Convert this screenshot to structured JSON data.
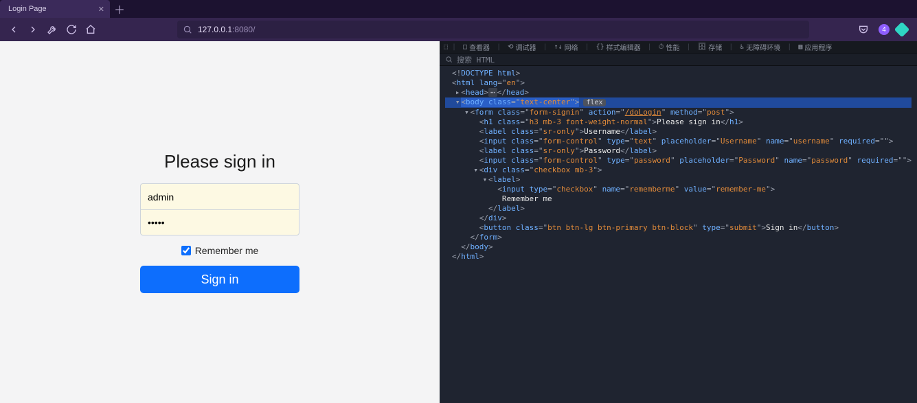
{
  "browser": {
    "tab_title": "Login Page",
    "address_host": "127.0.0.1",
    "address_rest": ":8080/",
    "badge_count": "4"
  },
  "login": {
    "heading": "Please sign in",
    "username_value": "admin",
    "username_placeholder": "Username",
    "password_value": "•••••",
    "password_placeholder": "Password",
    "remember_label": "Remember me",
    "submit_label": "Sign in"
  },
  "devtools": {
    "top_tabs": [
      "查看器",
      "调试器",
      "网络",
      "样式编辑器",
      "性能",
      "存储",
      "无障碍环境",
      "应用程序"
    ],
    "search_placeholder": "搜索 HTML",
    "flex_badge": "flex",
    "lines": [
      {
        "indent": 0,
        "tw": "",
        "html": "<span class='c-punct'>&lt;!</span><span class='c-tag'>DOCTYPE</span> <span class='c-attr'>html</span><span class='c-punct'>&gt;</span>"
      },
      {
        "indent": 0,
        "tw": "",
        "html": "<span class='c-punct'>&lt;</span><span class='c-tag'>html</span> <span class='c-attr'>lang</span><span class='c-punct'>=&quot;</span><span class='c-val'>en</span><span class='c-punct'>&quot;&gt;</span>"
      },
      {
        "indent": 1,
        "tw": "▸",
        "html": "<span class='c-punct'>&lt;</span><span class='c-tag'>head</span><span class='c-punct'>&gt;</span><span class='c-dots'>⋯</span><span class='c-punct'>&lt;/</span><span class='c-tag'>head</span><span class='c-punct'>&gt;</span>"
      },
      {
        "indent": 1,
        "tw": "▾",
        "selected": true,
        "html": "<span class='c-punct'>&lt;</span><span class='c-tag'>body</span> <span class='c-attr'>class</span><span class='c-punct'>=&quot;</span><span class='c-val'>text-center</span><span class='c-punct'>&quot;&gt;</span>"
      },
      {
        "indent": 2,
        "tw": "▾",
        "html": "<span class='c-punct'>&lt;</span><span class='c-tag'>form</span> <span class='c-attr'>class</span><span class='c-punct'>=&quot;</span><span class='c-val'>form-signin</span><span class='c-punct'>&quot;</span> <span class='c-attr'>action</span><span class='c-punct'>=&quot;</span><span class='c-link'>/doLogin</span><span class='c-punct'>&quot;</span> <span class='c-attr'>method</span><span class='c-punct'>=&quot;</span><span class='c-val'>post</span><span class='c-punct'>&quot;&gt;</span>"
      },
      {
        "indent": 3,
        "tw": "",
        "html": "<span class='c-punct'>&lt;</span><span class='c-tag'>h1</span> <span class='c-attr'>class</span><span class='c-punct'>=&quot;</span><span class='c-val'>h3 mb-3 font-weight-normal</span><span class='c-punct'>&quot;&gt;</span><span class='c-text'>Please sign in</span><span class='c-punct'>&lt;/</span><span class='c-tag'>h1</span><span class='c-punct'>&gt;</span>"
      },
      {
        "indent": 3,
        "tw": "",
        "html": "<span class='c-punct'>&lt;</span><span class='c-tag'>label</span> <span class='c-attr'>class</span><span class='c-punct'>=&quot;</span><span class='c-val'>sr-only</span><span class='c-punct'>&quot;&gt;</span><span class='c-text'>Username</span><span class='c-punct'>&lt;/</span><span class='c-tag'>label</span><span class='c-punct'>&gt;</span>"
      },
      {
        "indent": 3,
        "tw": "",
        "html": "<span class='c-punct'>&lt;</span><span class='c-tag'>input</span> <span class='c-attr'>class</span><span class='c-punct'>=&quot;</span><span class='c-val'>form-control</span><span class='c-punct'>&quot;</span> <span class='c-attr'>type</span><span class='c-punct'>=&quot;</span><span class='c-val'>text</span><span class='c-punct'>&quot;</span> <span class='c-attr'>placeholder</span><span class='c-punct'>=&quot;</span><span class='c-val'>Username</span><span class='c-punct'>&quot;</span> <span class='c-attr'>name</span><span class='c-punct'>=&quot;</span><span class='c-val'>username</span><span class='c-punct'>&quot;</span> <span class='c-attr'>required</span><span class='c-punct'>=&quot;&quot;&gt;</span>"
      },
      {
        "indent": 3,
        "tw": "",
        "html": "<span class='c-punct'>&lt;</span><span class='c-tag'>label</span> <span class='c-attr'>class</span><span class='c-punct'>=&quot;</span><span class='c-val'>sr-only</span><span class='c-punct'>&quot;&gt;</span><span class='c-text'>Password</span><span class='c-punct'>&lt;/</span><span class='c-tag'>label</span><span class='c-punct'>&gt;</span>"
      },
      {
        "indent": 3,
        "tw": "",
        "html": "<span class='c-punct'>&lt;</span><span class='c-tag'>input</span> <span class='c-attr'>class</span><span class='c-punct'>=&quot;</span><span class='c-val'>form-control</span><span class='c-punct'>&quot;</span> <span class='c-attr'>type</span><span class='c-punct'>=&quot;</span><span class='c-val'>password</span><span class='c-punct'>&quot;</span> <span class='c-attr'>placeholder</span><span class='c-punct'>=&quot;</span><span class='c-val'>Password</span><span class='c-punct'>&quot;</span> <span class='c-attr'>name</span><span class='c-punct'>=&quot;</span><span class='c-val'>password</span><span class='c-punct'>&quot;</span> <span class='c-attr'>required</span><span class='c-punct'>=&quot;&quot;&gt;</span>"
      },
      {
        "indent": 3,
        "tw": "▾",
        "html": "<span class='c-punct'>&lt;</span><span class='c-tag'>div</span> <span class='c-attr'>class</span><span class='c-punct'>=&quot;</span><span class='c-val'>checkbox mb-3</span><span class='c-punct'>&quot;&gt;</span>"
      },
      {
        "indent": 4,
        "tw": "▾",
        "html": "<span class='c-punct'>&lt;</span><span class='c-tag'>label</span><span class='c-punct'>&gt;</span>"
      },
      {
        "indent": 5,
        "tw": "",
        "html": "<span class='c-punct'>&lt;</span><span class='c-tag'>input</span> <span class='c-attr'>type</span><span class='c-punct'>=&quot;</span><span class='c-val'>checkbox</span><span class='c-punct'>&quot;</span> <span class='c-attr'>name</span><span class='c-punct'>=&quot;</span><span class='c-val'>rememberme</span><span class='c-punct'>&quot;</span> <span class='c-attr'>value</span><span class='c-punct'>=&quot;</span><span class='c-val'>remember-me</span><span class='c-punct'>&quot;&gt;</span>"
      },
      {
        "indent": 5,
        "tw": "",
        "html": "<span class='c-text'> Remember me </span>"
      },
      {
        "indent": 4,
        "tw": "",
        "html": "<span class='c-punct'>&lt;/</span><span class='c-tag'>label</span><span class='c-punct'>&gt;</span>"
      },
      {
        "indent": 3,
        "tw": "",
        "html": "<span class='c-punct'>&lt;/</span><span class='c-tag'>div</span><span class='c-punct'>&gt;</span>"
      },
      {
        "indent": 3,
        "tw": "",
        "html": "<span class='c-punct'>&lt;</span><span class='c-tag'>button</span> <span class='c-attr'>class</span><span class='c-punct'>=&quot;</span><span class='c-val'>btn btn-lg btn-primary btn-block</span><span class='c-punct'>&quot;</span> <span class='c-attr'>type</span><span class='c-punct'>=&quot;</span><span class='c-val'>submit</span><span class='c-punct'>&quot;&gt;</span><span class='c-text'>Sign in</span><span class='c-punct'>&lt;/</span><span class='c-tag'>button</span><span class='c-punct'>&gt;</span>"
      },
      {
        "indent": 2,
        "tw": "",
        "html": "<span class='c-punct'>&lt;/</span><span class='c-tag'>form</span><span class='c-punct'>&gt;</span>"
      },
      {
        "indent": 1,
        "tw": "",
        "html": "<span class='c-punct'>&lt;/</span><span class='c-tag'>body</span><span class='c-punct'>&gt;</span>"
      },
      {
        "indent": 0,
        "tw": "",
        "html": "<span class='c-punct'>&lt;/</span><span class='c-tag'>html</span><span class='c-punct'>&gt;</span>"
      }
    ]
  }
}
